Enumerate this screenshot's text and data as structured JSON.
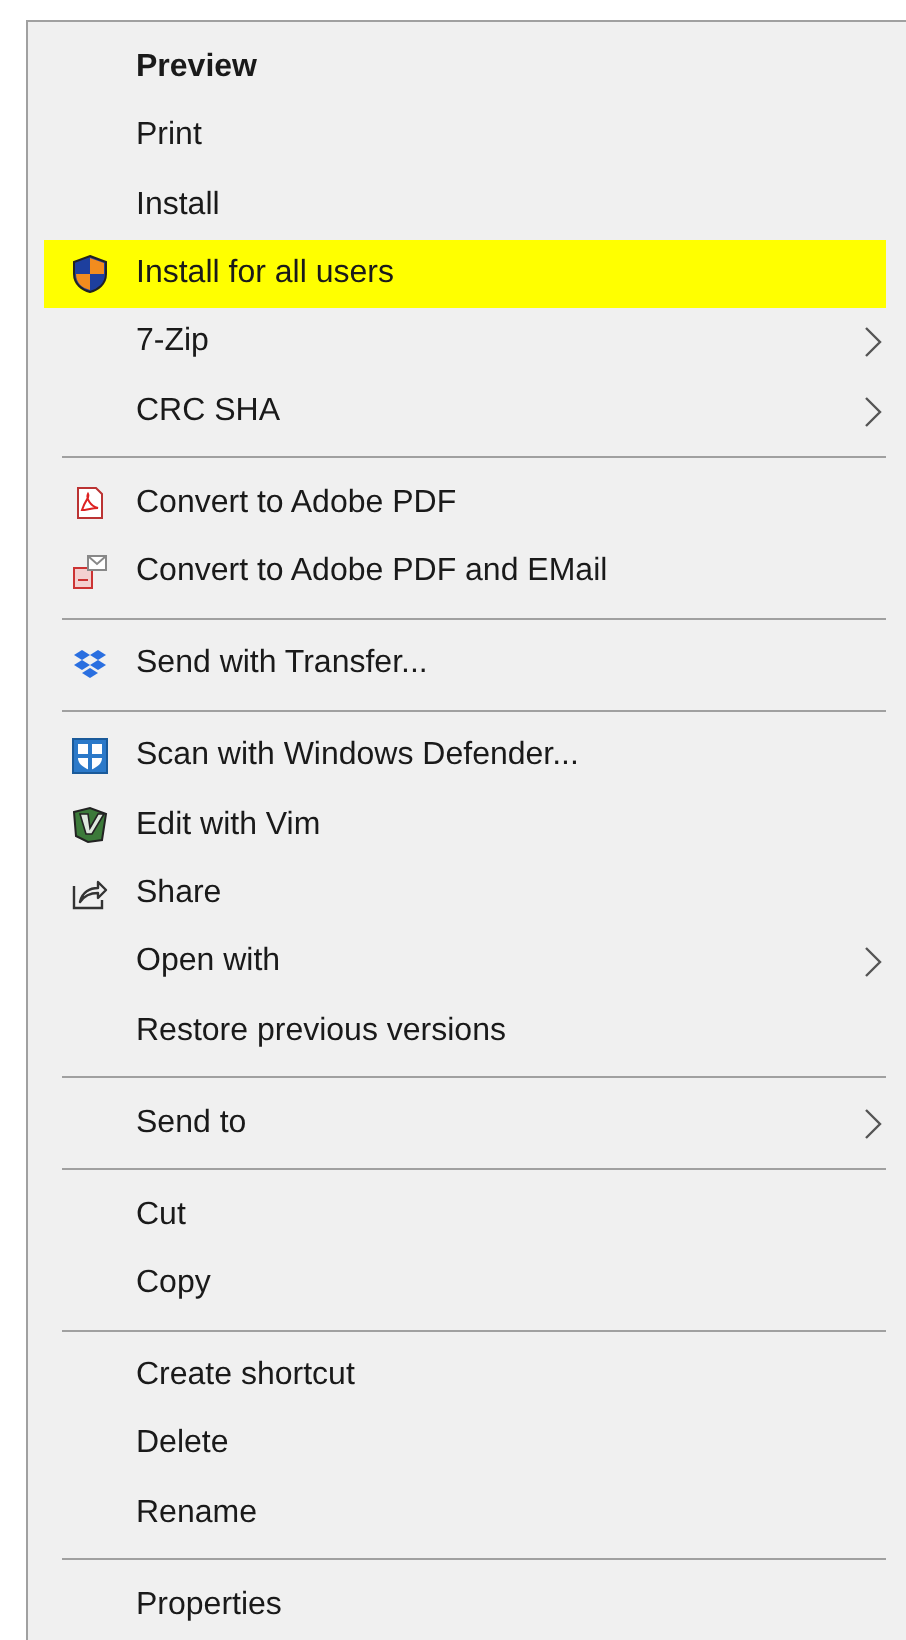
{
  "menu": {
    "items": [
      {
        "kind": "item",
        "label": "Preview",
        "default": true,
        "selected": false,
        "submenu": false
      },
      {
        "kind": "item",
        "label": "Print",
        "default": false,
        "selected": false,
        "submenu": false
      },
      {
        "kind": "item",
        "label": "Install",
        "default": false,
        "selected": false,
        "submenu": false
      },
      {
        "kind": "item",
        "label": "Install for all users",
        "default": false,
        "selected": true,
        "submenu": false
      },
      {
        "kind": "item",
        "label": "7-Zip",
        "default": false,
        "selected": false,
        "submenu": true
      },
      {
        "kind": "item",
        "label": "CRC SHA",
        "default": false,
        "selected": false,
        "submenu": true
      },
      {
        "kind": "separator"
      },
      {
        "kind": "item",
        "label": "Convert to Adobe PDF",
        "default": false,
        "selected": false,
        "submenu": false
      },
      {
        "kind": "item",
        "label": "Convert to Adobe PDF and EMail",
        "default": false,
        "selected": false,
        "submenu": false
      },
      {
        "kind": "separator"
      },
      {
        "kind": "item",
        "label": "Send with Transfer...",
        "default": false,
        "selected": false,
        "submenu": false
      },
      {
        "kind": "separator"
      },
      {
        "kind": "item",
        "label": "Scan with Windows Defender...",
        "default": false,
        "selected": false,
        "submenu": false
      },
      {
        "kind": "item",
        "label": "Edit with Vim",
        "default": false,
        "selected": false,
        "submenu": false
      },
      {
        "kind": "item",
        "label": "Share",
        "default": false,
        "selected": false,
        "submenu": false
      },
      {
        "kind": "item",
        "label": "Open with",
        "default": false,
        "selected": false,
        "submenu": true
      },
      {
        "kind": "item",
        "label": "Restore previous versions",
        "default": false,
        "selected": false,
        "submenu": false
      },
      {
        "kind": "separator"
      },
      {
        "kind": "item",
        "label": "Send to",
        "default": false,
        "selected": false,
        "submenu": true
      },
      {
        "kind": "separator"
      },
      {
        "kind": "item",
        "label": "Cut",
        "default": false,
        "selected": false,
        "submenu": false
      },
      {
        "kind": "item",
        "label": "Copy",
        "default": false,
        "selected": false,
        "submenu": false
      },
      {
        "kind": "separator"
      },
      {
        "kind": "item",
        "label": "Create shortcut",
        "default": false,
        "selected": false,
        "submenu": false
      },
      {
        "kind": "item",
        "label": "Delete",
        "default": false,
        "selected": false,
        "submenu": false
      },
      {
        "kind": "item",
        "label": "Rename",
        "default": false,
        "selected": false,
        "submenu": false
      },
      {
        "kind": "separator"
      },
      {
        "kind": "item",
        "label": "Properties",
        "default": false,
        "selected": false,
        "submenu": false
      }
    ]
  }
}
